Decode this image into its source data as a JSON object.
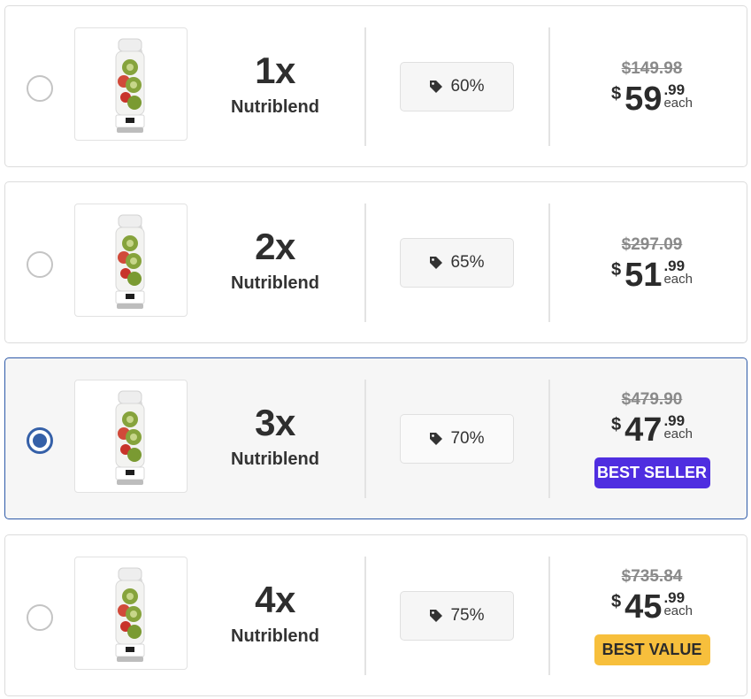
{
  "offers": [
    {
      "quantity": "1x",
      "product": "Nutriblend",
      "discount": "60%",
      "old_price": "$149.98",
      "currency": "$",
      "price_whole": "59",
      "price_cents": ".99",
      "unit": "each",
      "badge": "",
      "selected": false
    },
    {
      "quantity": "2x",
      "product": "Nutriblend",
      "discount": "65%",
      "old_price": "$297.09",
      "currency": "$",
      "price_whole": "51",
      "price_cents": ".99",
      "unit": "each",
      "badge": "",
      "selected": false
    },
    {
      "quantity": "3x",
      "product": "Nutriblend",
      "discount": "70%",
      "old_price": "$479.90",
      "currency": "$",
      "price_whole": "47",
      "price_cents": ".99",
      "unit": "each",
      "badge": "BEST SELLER",
      "selected": true
    },
    {
      "quantity": "4x",
      "product": "Nutriblend",
      "discount": "75%",
      "old_price": "$735.84",
      "currency": "$",
      "price_whole": "45",
      "price_cents": ".99",
      "unit": "each",
      "badge": "BEST VALUE",
      "selected": false
    }
  ],
  "icons": {
    "discount": "price-tag-icon",
    "product_image": "blender-bottle-image"
  },
  "colors": {
    "selected_border": "#2e5aa8",
    "radio_selected": "#3560a8",
    "best_seller_badge": "#4f2ee0",
    "best_value_badge": "#f7bf3c"
  }
}
